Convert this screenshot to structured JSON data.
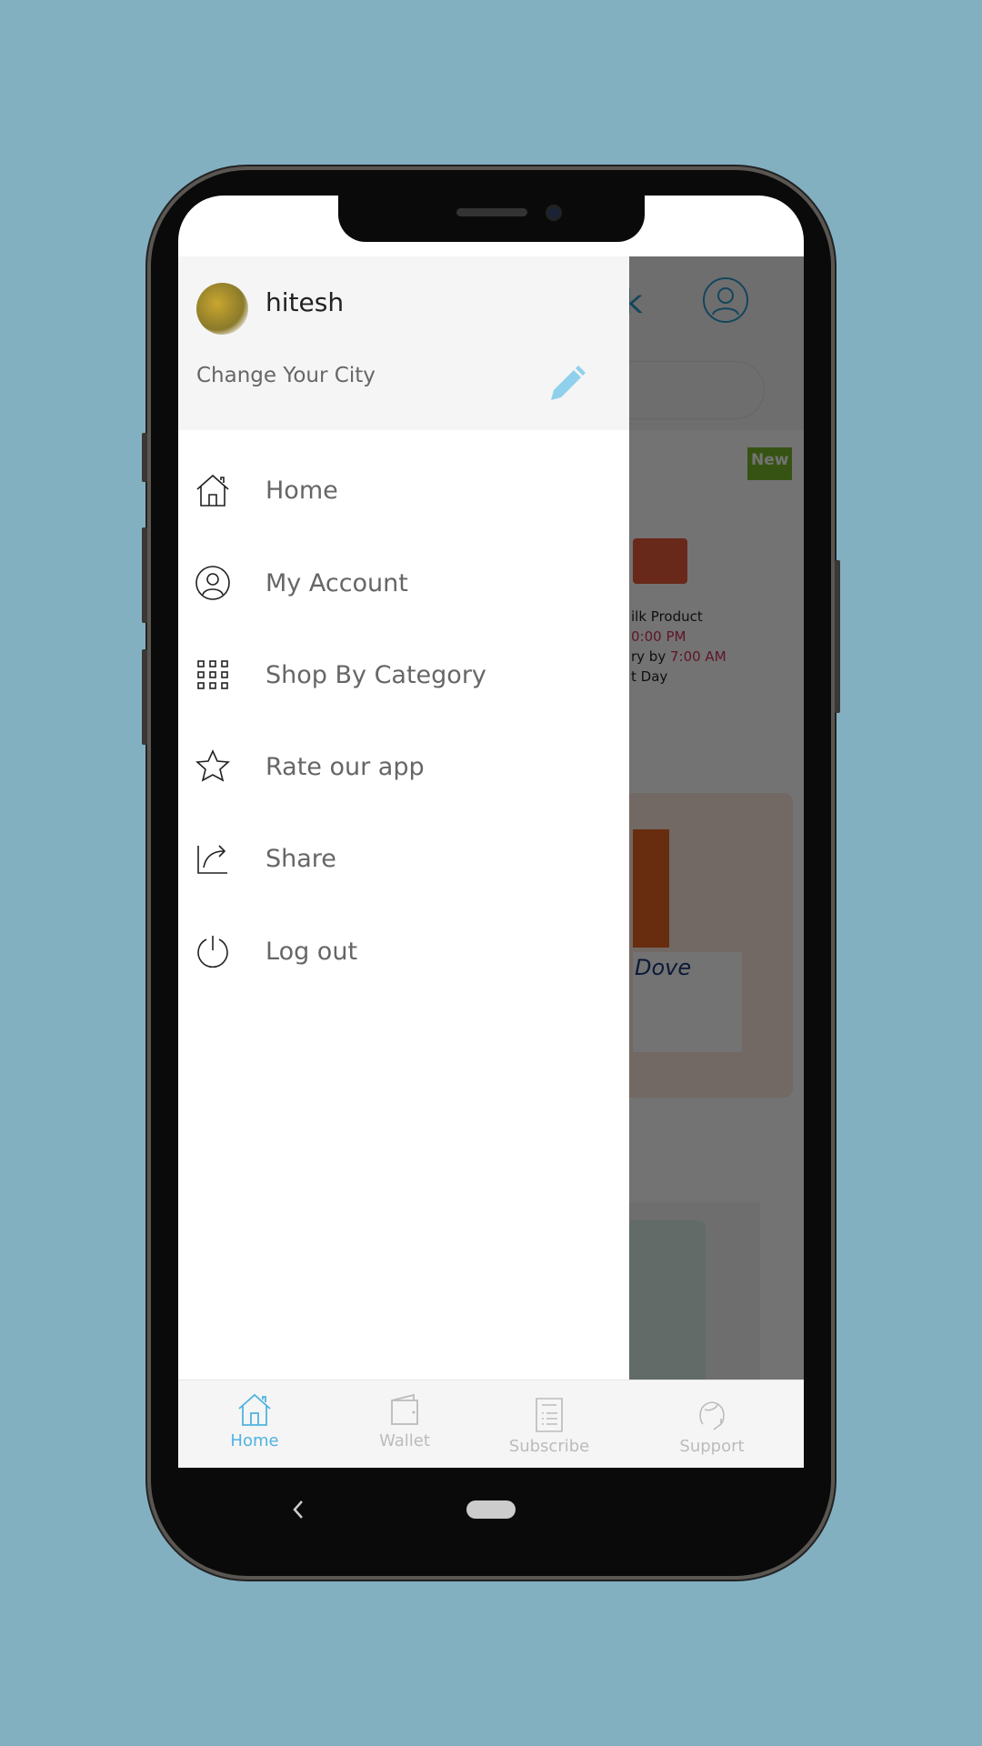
{
  "user": {
    "name": "hitesh",
    "change_city": "Change Your City"
  },
  "menu": [
    {
      "label": "Home",
      "icon": "home-icon"
    },
    {
      "label": "My Account",
      "icon": "user-icon"
    },
    {
      "label": "Shop By Category",
      "icon": "grid-icon"
    },
    {
      "label": "Rate our app",
      "icon": "star-icon"
    },
    {
      "label": "Share",
      "icon": "share-icon"
    },
    {
      "label": "Log out",
      "icon": "power-icon"
    }
  ],
  "background": {
    "title_fragment": "k",
    "badge": "New",
    "line1": "ilk Product",
    "line2": "0:00 PM",
    "line3a": "ry by ",
    "line3b": "7:00 AM",
    "line4": "t Day",
    "brand": "Dove"
  },
  "bottom_nav": [
    {
      "label": "Home",
      "icon": "home-icon",
      "active": true
    },
    {
      "label": "Wallet",
      "icon": "wallet-icon"
    },
    {
      "label": "Subscribe",
      "icon": "list-icon"
    },
    {
      "label": "Support",
      "icon": "headset-icon"
    }
  ],
  "colors": {
    "accent": "#4fb3e0",
    "background": "#83b0c1",
    "badge": "#6a9a1a",
    "highlight": "#d0305a"
  }
}
